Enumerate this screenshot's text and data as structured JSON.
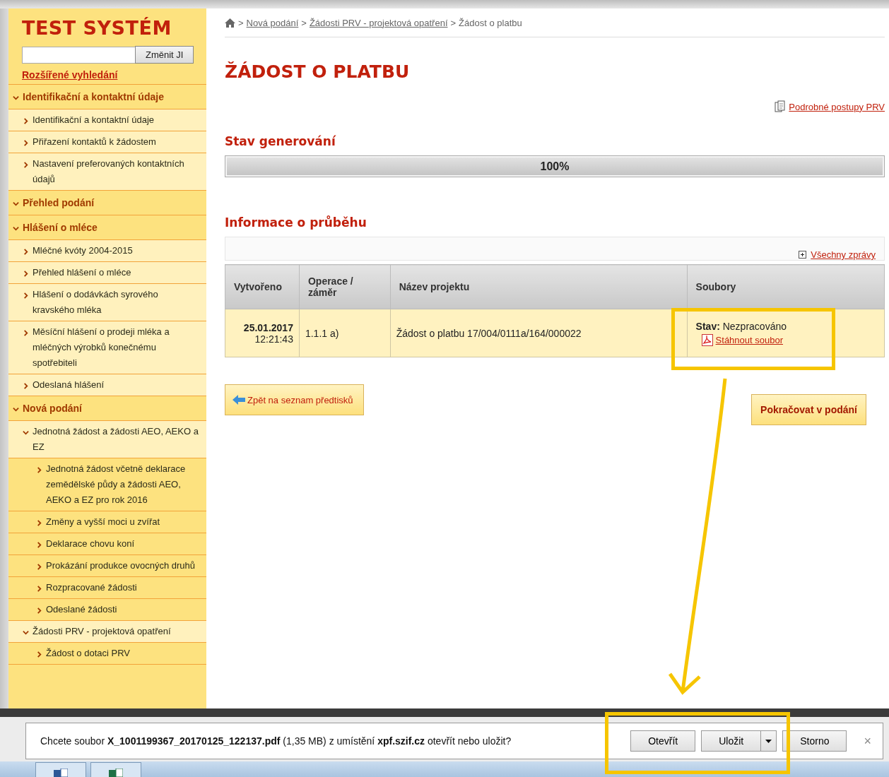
{
  "header": {
    "title": "TEST SYSTÉM",
    "search_button": "Změnit JI",
    "advanced_search_link": "Rozšířené vyhledání"
  },
  "sidebar": {
    "items": [
      {
        "label": "Identifikační a kontaktní údaje",
        "expanded": true,
        "children": [
          {
            "label": "Identifikační a kontaktní údaje",
            "expanded": false
          },
          {
            "label": "Přiřazení kontaktů k žádostem",
            "expanded": false
          },
          {
            "label": "Nastavení preferovaných kontaktních údajů",
            "expanded": false
          }
        ]
      },
      {
        "label": "Přehled podání",
        "expanded": true
      },
      {
        "label": "Hlášení o mléce",
        "expanded": true,
        "children": [
          {
            "label": "Mléčné kvóty 2004-2015",
            "expanded": false
          },
          {
            "label": "Přehled hlášení o mléce",
            "expanded": false
          },
          {
            "label": "Hlášení o dodávkách syrového kravského mléka",
            "expanded": false
          },
          {
            "label": "Měsíční hlášení o prodeji mléka a mléčných výrobků konečnému spotřebiteli",
            "expanded": false
          },
          {
            "label": "Odeslaná hlášení",
            "expanded": false
          }
        ]
      },
      {
        "label": "Nová podání",
        "expanded": true,
        "children": [
          {
            "label": "Jednotná žádost a žádosti AEO, AEKO a EZ",
            "expanded": true,
            "children": [
              {
                "label": "Jednotná žádost včetně deklarace zemědělské půdy a žádosti AEO, AEKO a EZ pro rok 2016",
                "expanded": false
              },
              {
                "label": "Změny a vyšší moci u zvířat",
                "expanded": false
              },
              {
                "label": "Deklarace chovu koní",
                "expanded": false
              },
              {
                "label": "Prokázání produkce ovocných druhů",
                "expanded": false
              },
              {
                "label": "Rozpracované žádosti",
                "expanded": false
              },
              {
                "label": "Odeslané žádosti",
                "expanded": false
              }
            ]
          },
          {
            "label": "Žádosti PRV - projektová opatření",
            "expanded": true,
            "children": [
              {
                "label": "Žádost o dotaci PRV",
                "expanded": false
              }
            ]
          }
        ]
      }
    ]
  },
  "breadcrumb": {
    "separator": ">",
    "links": [
      "Nová podání",
      "Žádosti PRV - projektová opatření"
    ],
    "current": "Žádost o platbu"
  },
  "page_title": "ŽÁDOST O PLATBU",
  "help_link": "Podrobné postupy PRV",
  "generation": {
    "heading": "Stav generování",
    "level": 1,
    "reading": "100%"
  },
  "progress_info": {
    "heading": "Informace o průběhu",
    "all_messages_link": "Všechny zprávy"
  },
  "table": {
    "columns": [
      "Vytvořeno",
      "Operace / záměr",
      "Název projektu",
      "Soubory"
    ],
    "rows": [
      {
        "date": "25.01.2017",
        "time": "12:21:43",
        "operation": "1.1.1 a)",
        "project": "Žádost o platbu 17/004/0111a/164/000022",
        "status": "**Stav:** Nezpracováno",
        "download_link": "Stáhnout soubor"
      }
    ]
  },
  "buttons": {
    "back": "Zpět na seznam předtisků",
    "continue": "Pokračovat v podání"
  },
  "download_bar": {
    "message": "Chcete soubor **X_1001199367_20170125_122137.pdf** (1,35 MB) z umístění **xpf.szif.cz** otevřít nebo uložit?",
    "buttons": [
      "Otevřít",
      "Uložit",
      "Storno"
    ],
    "close": "×"
  }
}
